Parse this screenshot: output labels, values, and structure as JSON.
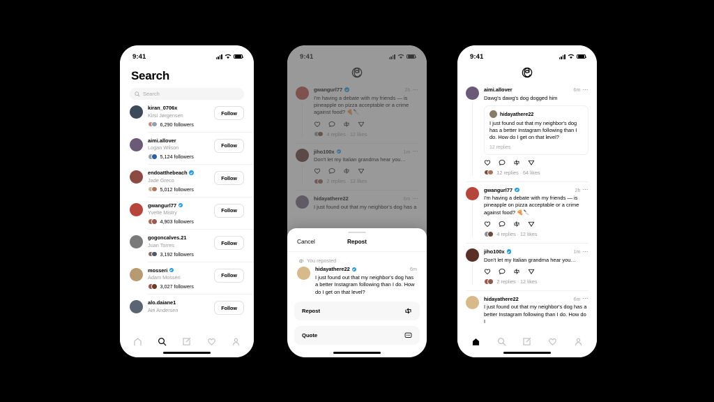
{
  "statusbar": {
    "time": "9:41",
    "wifi_icon": "wifi-icon",
    "cellular_icon": "cellular-bars-icon",
    "battery_icon": "battery-icon"
  },
  "phone1": {
    "title": "Search",
    "search": {
      "placeholder": "Search",
      "icon": "search-icon",
      "value": ""
    },
    "follow_label": "Follow",
    "results": [
      {
        "username": "kiran_0706x",
        "realname": "Kirsi Jørgensen",
        "followers": "6,290 followers",
        "verified": false,
        "avatar": "#3c4a5a",
        "mini1": "#c98a7a",
        "mini2": "#8fa2b8"
      },
      {
        "username": "aimi.allover",
        "realname": "Logan Wilson",
        "followers": "5,124 followers",
        "verified": false,
        "avatar": "#6b5a77",
        "mini1": "#9aa3ad",
        "mini2": "#2b5fa8"
      },
      {
        "username": "endoatthebeach",
        "realname": "Jade Greco",
        "followers": "5,012 followers",
        "verified": true,
        "avatar": "#8c4b42",
        "mini1": "#c9b79a",
        "mini2": "#b0795c"
      },
      {
        "username": "gwangurl77",
        "realname": "Yvette Mistry",
        "followers": "4,903 followers",
        "verified": true,
        "avatar": "#b8453c",
        "mini1": "#b36a4a",
        "mini2": "#9c5a52"
      },
      {
        "username": "gogoncalves.21",
        "realname": "Juan Torres",
        "followers": "3,192 followers",
        "verified": false,
        "avatar": "#7a7a7a",
        "mini1": "#8d6a5e",
        "mini2": "#4a5a6e"
      },
      {
        "username": "mosseri",
        "realname": "Adam Mosseri",
        "followers": "3,027 followers",
        "verified": true,
        "avatar": "#b79a72",
        "mini1": "#a6564a",
        "mini2": "#6e3a28"
      },
      {
        "username": "alo.daiane1",
        "realname": "Airi Andersen",
        "followers": "",
        "verified": false,
        "avatar": "#5b6472",
        "mini1": "#8a8a8a",
        "mini2": "#6a6a6a"
      }
    ],
    "tabs": [
      {
        "name": "home",
        "label": "Home",
        "active": false
      },
      {
        "name": "search",
        "label": "Search",
        "active": true
      },
      {
        "name": "compose",
        "label": "Compose",
        "active": false
      },
      {
        "name": "activity",
        "label": "Activity",
        "active": false
      },
      {
        "name": "profile",
        "label": "Profile",
        "active": false
      }
    ]
  },
  "phone2": {
    "logo_icon": "threads-logo-icon",
    "posts": [
      {
        "username": "gwangurl77",
        "verified": true,
        "time": "2h",
        "text": "I'm having a debate with my friends — is pineapple on pizza acceptable or a crime against food? 🍕🔪",
        "meta": "4 replies · 12 likes",
        "avatar": "#b8453c",
        "mini1": "#8a8f9a",
        "mini2": "#6e4a3a"
      },
      {
        "username": "jiho100x",
        "verified": true,
        "time": "1m",
        "text": "Don't let my Italian grandma hear you…",
        "meta": "2 replies · 12 likes",
        "avatar": "#5a2f26",
        "mini1": "#a6564a",
        "mini2": "#8a5a4a"
      },
      {
        "username": "hidayathere22",
        "verified": false,
        "time": "6m",
        "text": "I just found out that my neighbor's dog has a",
        "meta": "",
        "avatar": "#6b5a77",
        "mini1": "#9a9a9a",
        "mini2": "#7a7a7a"
      }
    ],
    "sheet": {
      "cancel_label": "Cancel",
      "title": "Repost",
      "reposted_label": "You reposted",
      "repost_icon": "repost-icon",
      "post": {
        "username": "hidayathere22",
        "verified": true,
        "time": "6m",
        "text": "I just found out that my neighbor's dog has a better Instagram following than I do. How do I get on that level?",
        "avatar": "#d8b98a"
      },
      "actions": [
        {
          "label": "Repost",
          "icon": "repost-icon"
        },
        {
          "label": "Quote",
          "icon": "quote-icon"
        }
      ]
    }
  },
  "phone3": {
    "logo_icon": "threads-logo-icon",
    "posts": [
      {
        "username": "aimi.allover",
        "verified": false,
        "time": "6m",
        "text": "Dawg's dawg's dog dogged him",
        "meta": "12 replies · 64 likes",
        "avatar": "#6b5a77",
        "mini1": "#7a4a3a",
        "mini2": "#a6745c",
        "quote": {
          "username": "hidayathere22",
          "text": "I just found out that my neighbor's dog has a better Instagram following than I do. How do I get on that level?",
          "replies": "12 replies",
          "avatar": "#8a7a6a"
        }
      },
      {
        "username": "gwangurl77",
        "verified": true,
        "time": "2h",
        "text": "I'm having a debate with my friends — is pineapple on pizza acceptable or a crime against food? 🍕🔪",
        "meta": "4 replies · 12 likes",
        "avatar": "#b8453c",
        "mini1": "#8a8f9a",
        "mini2": "#6e4a3a"
      },
      {
        "username": "jiho100x",
        "verified": true,
        "time": "1m",
        "text": "Don't let my Italian grandma hear you…",
        "meta": "2 replies · 12 likes",
        "avatar": "#5a2f26",
        "mini1": "#a6564a",
        "mini2": "#8a5a4a"
      },
      {
        "username": "hidayathere22",
        "verified": false,
        "time": "6m",
        "text": "I just found out that my neighbor's dog has a better Instagram following than I do. How do I",
        "meta": "",
        "avatar": "#d8b98a",
        "mini1": "#9a9a9a",
        "mini2": "#7a7a7a"
      }
    ],
    "tabs": [
      {
        "name": "home",
        "label": "Home",
        "active": true
      },
      {
        "name": "search",
        "label": "Search",
        "active": false
      },
      {
        "name": "compose",
        "label": "Compose",
        "active": false
      },
      {
        "name": "activity",
        "label": "Activity",
        "active": false
      },
      {
        "name": "profile",
        "label": "Profile",
        "active": false
      }
    ]
  },
  "colors": {
    "background": "#000000",
    "verified_blue": "#1d9bf0",
    "muted": "#9a9a9a",
    "sheet_row": "#f7f7f7"
  }
}
